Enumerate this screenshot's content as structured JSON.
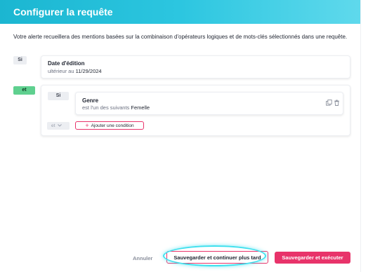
{
  "header": {
    "title": "Configurer la requête"
  },
  "intro": "Votre alerte recueillera des mentions basées sur la combinaison d'opérateurs logiques et de mots-clés sélectionnés dans une requête.",
  "rule1": {
    "operator": "Si",
    "title": "Date d'édition",
    "condition_prefix": "ultérieur au",
    "condition_value": "11/29/2024"
  },
  "group": {
    "operator": "et",
    "inner_operator": "Si",
    "rule": {
      "title": "Genre",
      "condition_prefix": "est l'un des suivants",
      "condition_value": "Femelle"
    },
    "join_select": "et",
    "add_condition_label": "Ajouter une condition"
  },
  "footer": {
    "cancel": "Annuler",
    "save_later": "Sauvegarder et continuer plus tard",
    "save_run": "Sauvegarder et exécuter"
  },
  "colors": {
    "header_start": "#1bb6d1",
    "header_end": "#5fd9ec",
    "accent": "#e8336a",
    "et_pill": "#5fd08f",
    "highlight": "#3fe0ee"
  }
}
